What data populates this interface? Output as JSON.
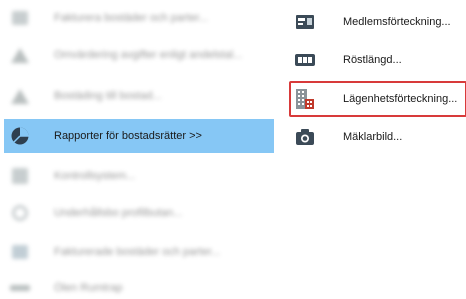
{
  "left_menu": {
    "items": [
      {
        "label": "Fakturera bostäder och parter...",
        "icon": "grid-icon"
      },
      {
        "label": "Omvärdering avgifter enligt andelstal...",
        "icon": "triangle-icon"
      },
      {
        "label": "Bostäding till bostad...",
        "icon": "triangle-icon"
      },
      {
        "label": "Rapporter för bostadsrätter >>",
        "icon": "pie-chart-icon"
      },
      {
        "label": "Kontrollsystem...",
        "icon": "document-icon"
      },
      {
        "label": "Underhållsbo profilbutan...",
        "icon": "gear-icon"
      },
      {
        "label": "Fakturerade bostäder och parter...",
        "icon": "folder-icon"
      },
      {
        "label": "Ölen Rumtrap",
        "icon": "bar-icon"
      }
    ]
  },
  "right_menu": {
    "items": [
      {
        "label": "Medlemsförteckning...",
        "icon": "member-register-icon"
      },
      {
        "label": "Röstlängd...",
        "icon": "voting-list-icon"
      },
      {
        "label": "Lägenhetsförteckning...",
        "icon": "apartment-building-icon"
      },
      {
        "label": "Mäklarbild...",
        "icon": "camera-icon"
      }
    ]
  },
  "colors": {
    "selected_bg": "#86c7f5",
    "highlight_border": "#d83a3a"
  }
}
